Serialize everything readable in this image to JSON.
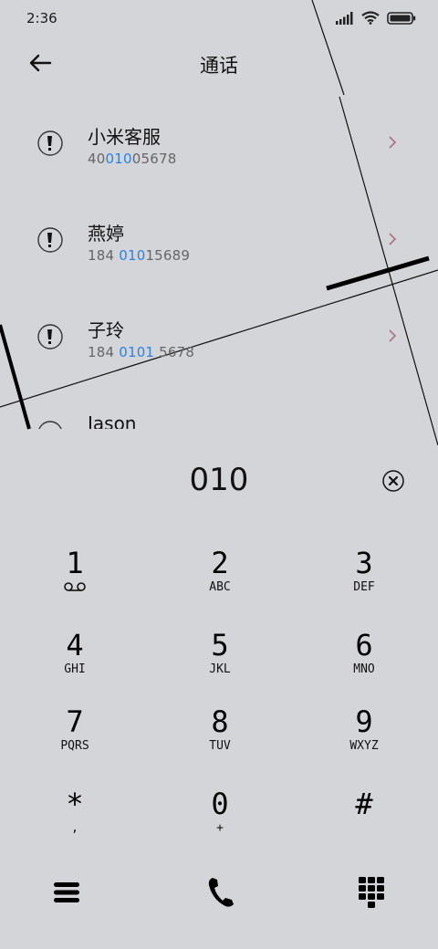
{
  "status_bar": {
    "time": "2:36"
  },
  "header": {
    "title": "通话"
  },
  "contacts": [
    {
      "name": "小米客服",
      "number_pre": "40",
      "number_hl": "010",
      "number_post": "05678"
    },
    {
      "name": "燕婷",
      "number_pre": "184 ",
      "number_hl": "010",
      "number_post": "15689"
    },
    {
      "name": "子玲",
      "number_pre": "184 ",
      "number_hl": "0101",
      "number_post": " 5678"
    },
    {
      "name": "Jason",
      "number_pre": "",
      "number_hl": "",
      "number_post": ""
    }
  ],
  "dialer": {
    "number": "010"
  },
  "keypad": [
    {
      "digit": "1",
      "letters": ""
    },
    {
      "digit": "2",
      "letters": "ABC"
    },
    {
      "digit": "3",
      "letters": "DEF"
    },
    {
      "digit": "4",
      "letters": "GHI"
    },
    {
      "digit": "5",
      "letters": "JKL"
    },
    {
      "digit": "6",
      "letters": "MNO"
    },
    {
      "digit": "7",
      "letters": "PQRS"
    },
    {
      "digit": "8",
      "letters": "TUV"
    },
    {
      "digit": "9",
      "letters": "WXYZ"
    },
    {
      "digit": "*",
      "letters": ","
    },
    {
      "digit": "0",
      "letters": "+"
    },
    {
      "digit": "#",
      "letters": ""
    }
  ],
  "icons": {
    "back": "arrow-left-icon",
    "clear": "clear-circle-icon",
    "menu": "menu-icon",
    "call": "phone-icon",
    "keypad_toggle": "dialpad-icon",
    "voicemail": "voicemail-icon"
  },
  "colors": {
    "background": "#d3d5d8",
    "highlight": "#2a82e4",
    "chevron": "#b07585"
  }
}
